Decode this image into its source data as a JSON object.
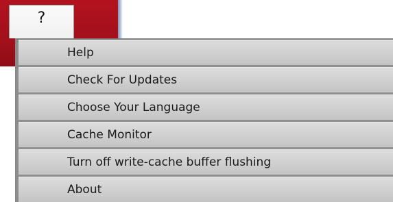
{
  "menubar": {
    "help_tab_label": "?"
  },
  "menu": {
    "items": [
      {
        "label": "Help"
      },
      {
        "label": "Check For Updates"
      },
      {
        "label": "Choose Your Language"
      },
      {
        "label": "Cache Monitor"
      },
      {
        "label": "Turn off write-cache buffer flushing"
      },
      {
        "label": "About"
      }
    ]
  },
  "colors": {
    "menubar_red": "#b3121f",
    "menu_item_gray": "#d2d2d2",
    "menu_border_gray": "#8e8e8e"
  }
}
